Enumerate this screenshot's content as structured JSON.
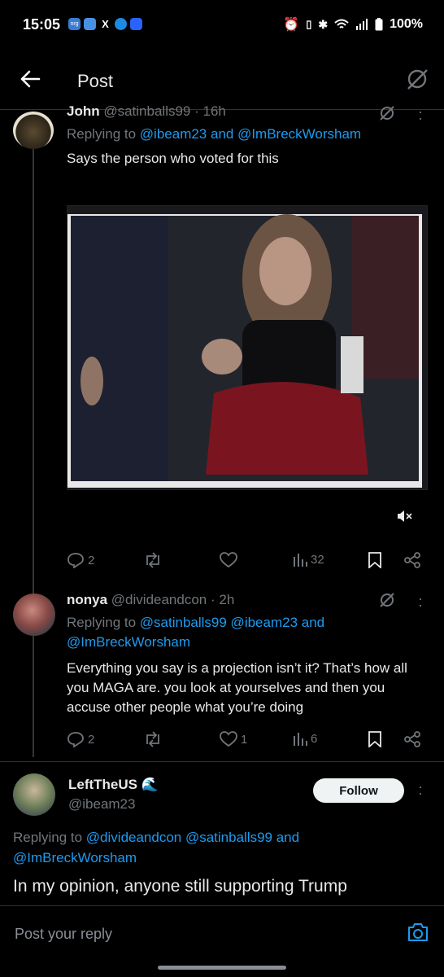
{
  "status_bar": {
    "time": "15:05",
    "apps": [
      "nrg",
      "slack",
      "X",
      "edge",
      "app"
    ],
    "battery": "100%",
    "icons": [
      "alarm-icon",
      "vibrate-icon",
      "bluetooth-icon",
      "wifi-icon",
      "signal-icon",
      "battery-icon"
    ]
  },
  "header": {
    "title": "Post"
  },
  "tweet1": {
    "name": "John",
    "handle": "@satinballs99",
    "time": "· 16h",
    "replying_prefix": "Replying to",
    "replying_to": "@ibeam23 and @ImBreckWorsham",
    "text": "Says the person who voted for this",
    "stats": {
      "replies": "2",
      "views": "32"
    }
  },
  "tweet2": {
    "name": "nonya",
    "handle": "@divideandcon",
    "time": "· 2h",
    "replying_prefix": "Replying to",
    "replying_line1": "@satinballs99 @ibeam23 and",
    "replying_line2": "@ImBreckWorsham",
    "text": "Everything you say is a projection isn’t it? That’s how all you MAGA are.  you look at yourselves and then you accuse other people what you’re doing",
    "stats": {
      "replies": "2",
      "likes": "1",
      "views": "6"
    }
  },
  "tweet3": {
    "name": "LeftTheUS",
    "emoji": "🌊",
    "handle": "@ibeam23",
    "follow_label": "Follow",
    "replying_prefix": "Replying to",
    "replying_line1": "@divideandcon @satinballs99 and",
    "replying_line2": "@ImBreckWorsham",
    "text": "In my opinion, anyone still supporting Trump"
  },
  "reply_bar": {
    "placeholder": "Post your reply"
  },
  "colors": {
    "accent": "#1d9bf0",
    "muted": "#71767b",
    "background": "#000000"
  }
}
